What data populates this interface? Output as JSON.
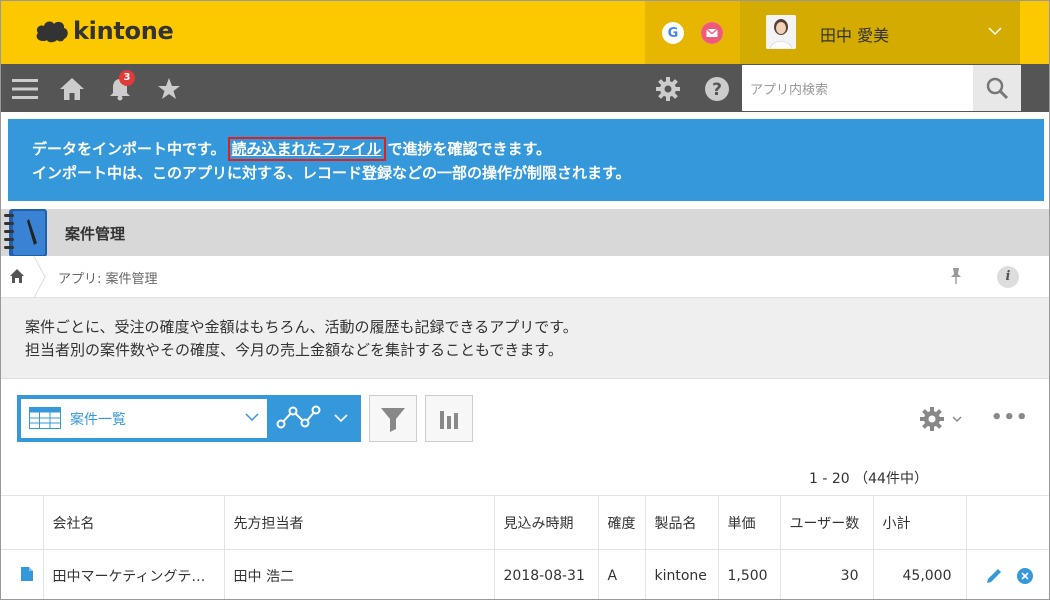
{
  "header": {
    "logo_text": "kintone",
    "google_label": "G",
    "user_name": "田中 愛美"
  },
  "toolbar": {
    "notification_count": "3",
    "search_placeholder": "アプリ内検索"
  },
  "notice": {
    "line1_before": "データをインポート中です。",
    "link": "読み込まれたファイル",
    "line1_after": "で進捗を確認できます。",
    "line2": "インポート中は、このアプリに対する、レコード登録などの一部の操作が制限されます。"
  },
  "app": {
    "title": "案件管理",
    "breadcrumb": "アプリ: 案件管理",
    "description_line1": "案件ごとに、受注の確度や金額はもちろん、活動の履歴も記録できるアプリです。",
    "description_line2": "担当者別の案件数やその確度、今月の売上金額などを集計することもできます。"
  },
  "view": {
    "name": "案件一覧",
    "pager": "1 - 20 （44件中）"
  },
  "table": {
    "columns": [
      "会社名",
      "先方担当者",
      "見込み時期",
      "確度",
      "製品名",
      "単価",
      "ユーザー数",
      "小計"
    ],
    "rows": [
      [
        "田中マーケティングテ…",
        "田中 浩二",
        "2018-08-31",
        "A",
        "kintone",
        "1,500",
        "30",
        "45,000"
      ]
    ]
  },
  "colors": {
    "header_yellow": "#fcc800",
    "toolbar_gray": "#555555",
    "notice_blue": "#3498db",
    "link_highlight_red": "#e02020"
  }
}
